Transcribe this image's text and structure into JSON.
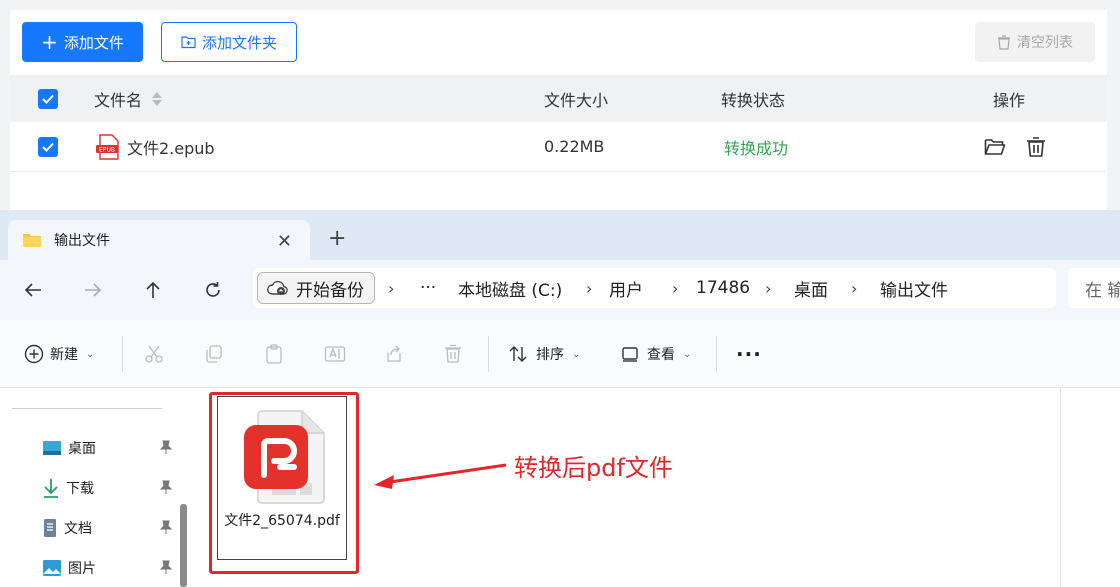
{
  "converter": {
    "add_file_label": "添加文件",
    "add_folder_label": "添加文件夹",
    "clear_list_label": "清空列表",
    "columns": {
      "filename": "文件名",
      "filesize": "文件大小",
      "status": "转换状态",
      "actions": "操作"
    },
    "rows": [
      {
        "filename": "文件2.epub",
        "filesize": "0.22MB",
        "status": "转换成功",
        "icon_label": "EPUB"
      }
    ],
    "colors": {
      "primary": "#1677ff",
      "success": "#2fa84f"
    }
  },
  "explorer": {
    "tab_title": "输出文件",
    "address": {
      "backup_label": "开始备份",
      "more": "···",
      "crumbs": [
        "本地磁盘 (C:)",
        "用户",
        "17486",
        "桌面",
        "输出文件"
      ]
    },
    "search_placeholder": "在 输",
    "toolbar": {
      "new_label": "新建",
      "sort_label": "排序",
      "view_label": "查看",
      "more": "···"
    },
    "sidebar": [
      {
        "label": "桌面",
        "icon": "desktop-icon"
      },
      {
        "label": "下载",
        "icon": "download-icon"
      },
      {
        "label": "文档",
        "icon": "document-icon"
      },
      {
        "label": "图片",
        "icon": "pictures-icon"
      }
    ],
    "files": [
      {
        "name": "文件2_65074.pdf",
        "icon": "pdf-icon"
      }
    ]
  },
  "annotation": {
    "text": "转换后pdf文件",
    "color": "#e4262a"
  }
}
